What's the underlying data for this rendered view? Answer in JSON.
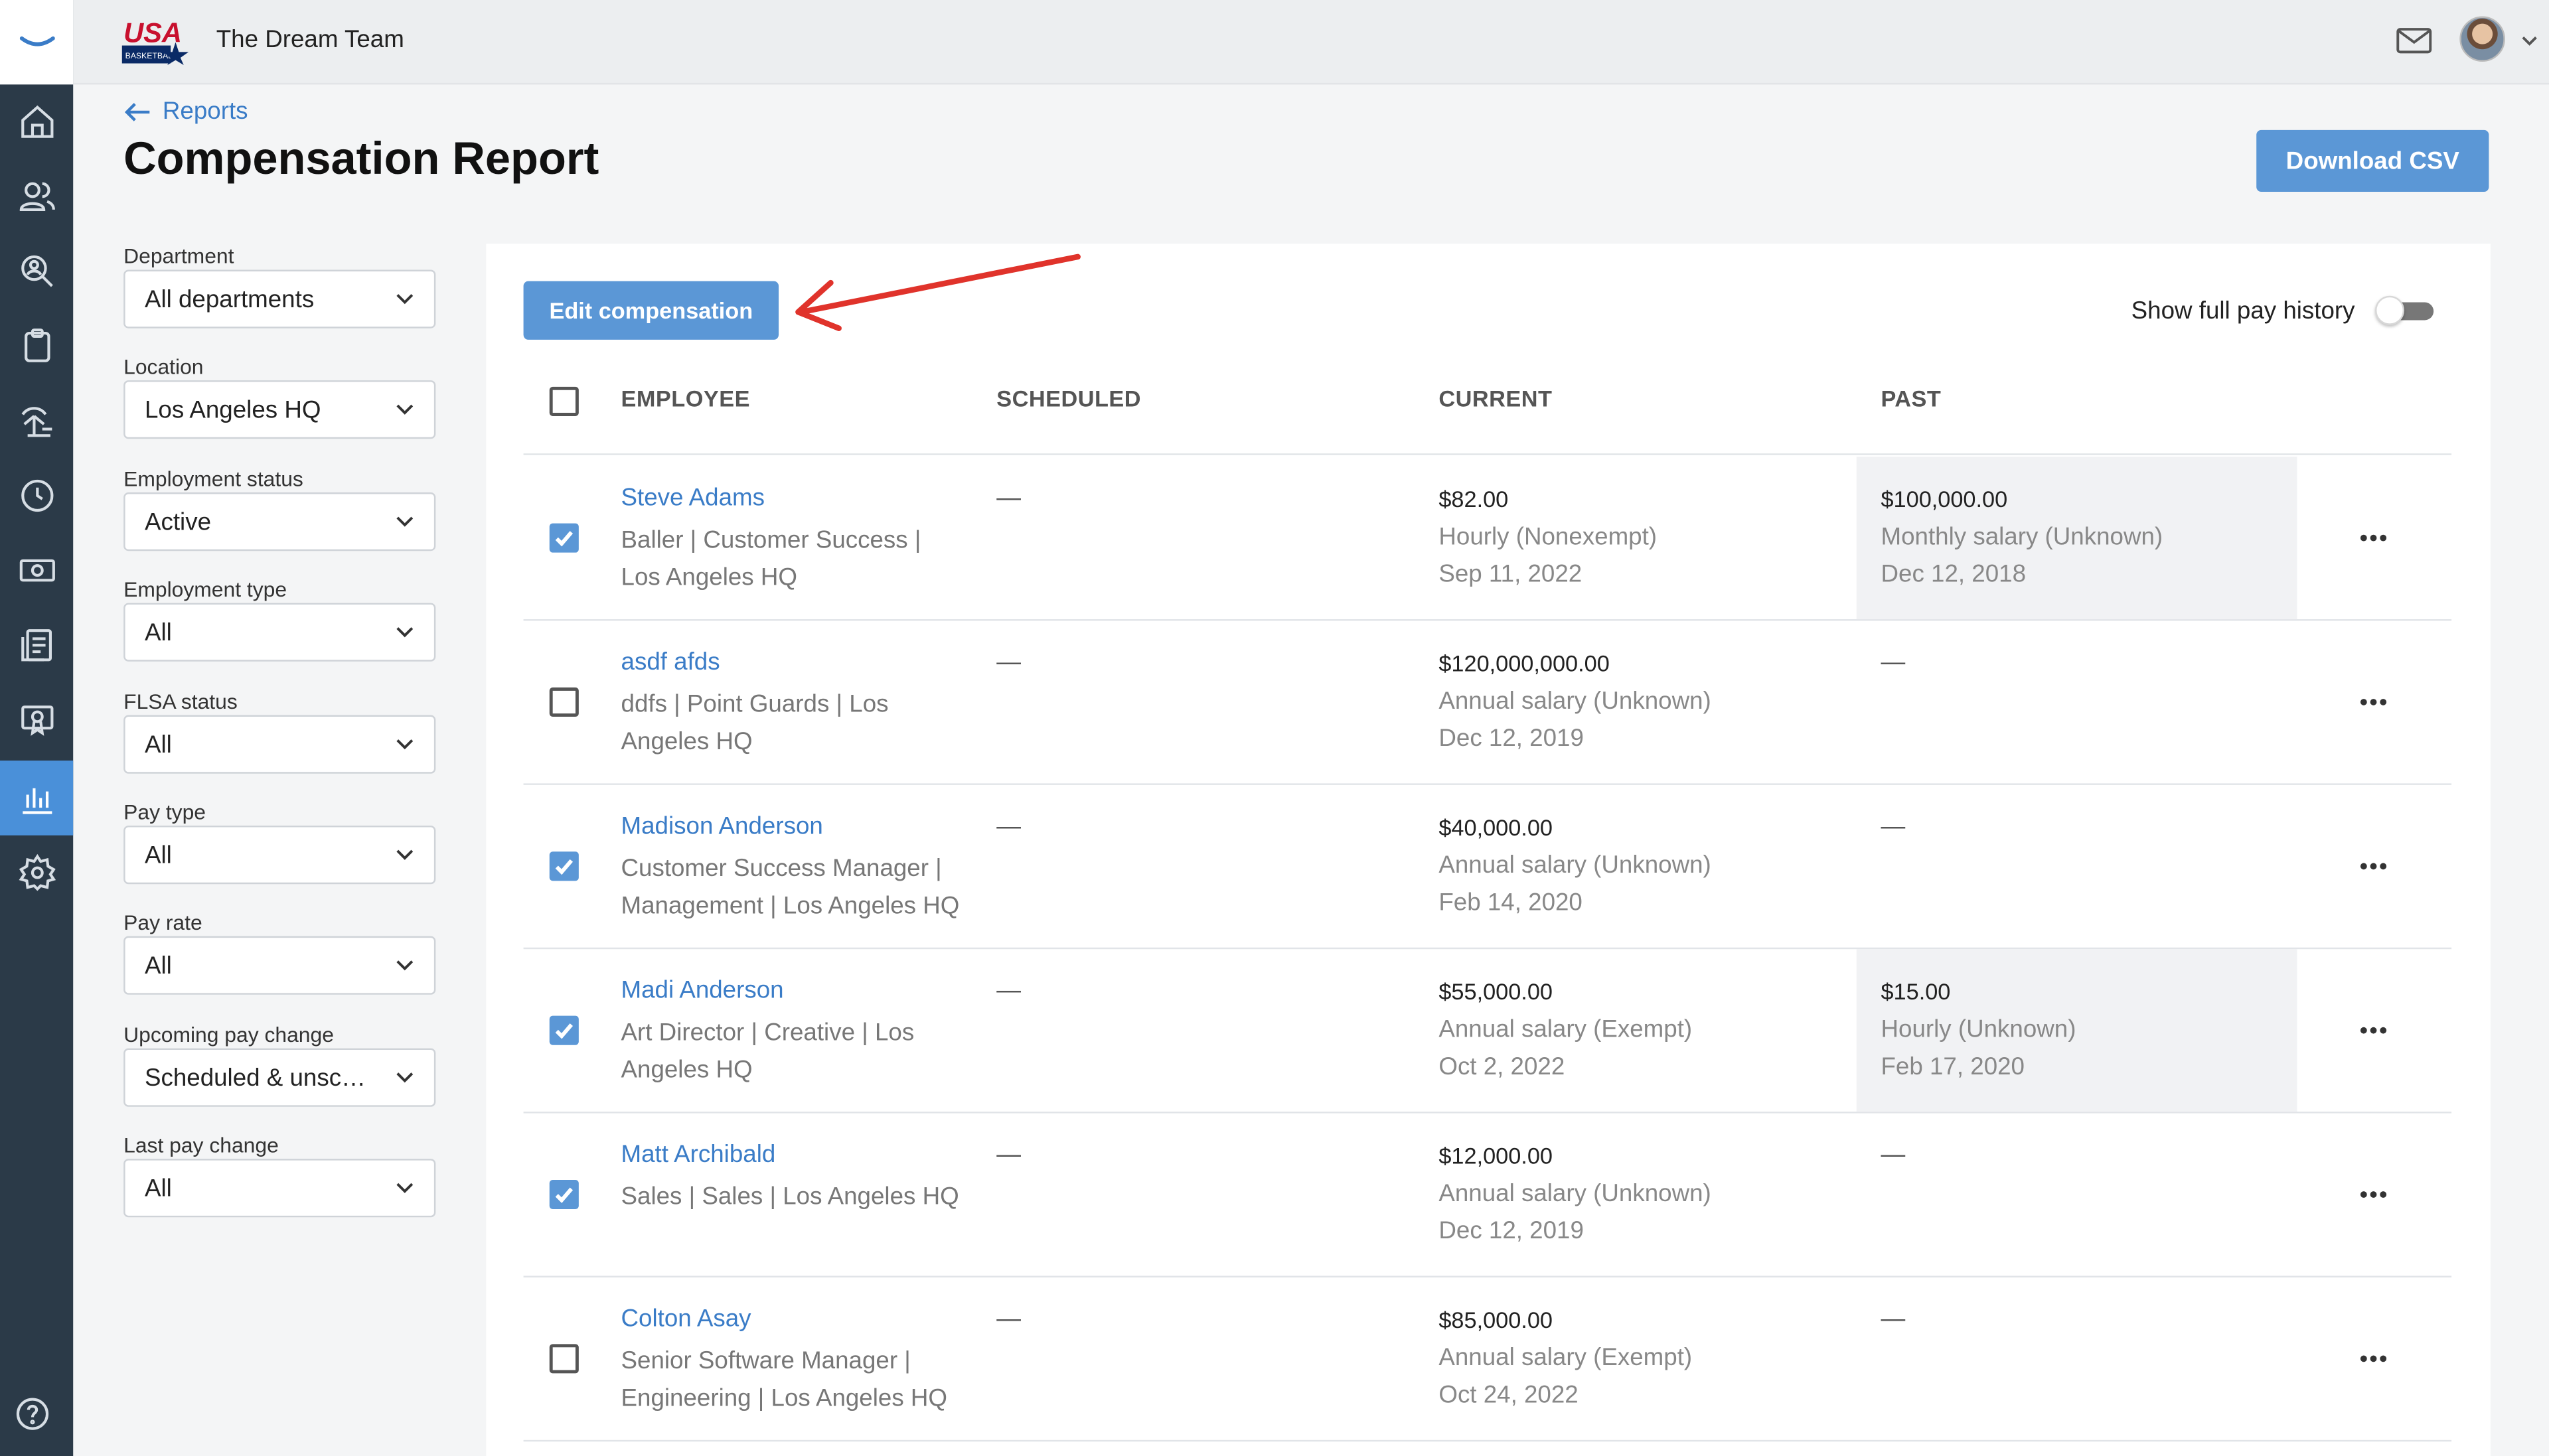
{
  "topbar": {
    "team_name": "The Dream Team"
  },
  "header": {
    "back_label": "Reports",
    "title": "Compensation Report",
    "download_label": "Download CSV"
  },
  "nav": [
    "home-icon",
    "people-icon",
    "search-person-icon",
    "clipboard-icon",
    "time-off-icon",
    "clock-icon",
    "money-icon",
    "documents-icon",
    "training-icon",
    "reports-icon",
    "settings-icon"
  ],
  "filters": [
    {
      "label": "Department",
      "value": "All departments"
    },
    {
      "label": "Location",
      "value": "Los Angeles HQ"
    },
    {
      "label": "Employment status",
      "value": "Active"
    },
    {
      "label": "Employment type",
      "value": "All"
    },
    {
      "label": "FLSA status",
      "value": "All"
    },
    {
      "label": "Pay type",
      "value": "All"
    },
    {
      "label": "Pay rate",
      "value": "All"
    },
    {
      "label": "Upcoming pay change",
      "value": "Scheduled & unscheduled"
    },
    {
      "label": "Last pay change",
      "value": "All"
    }
  ],
  "toolbar": {
    "edit_label": "Edit compensation",
    "toggle_label": "Show full pay history",
    "toggle_on": false
  },
  "table": {
    "headers": {
      "employee": "EMPLOYEE",
      "scheduled": "SCHEDULED",
      "current": "CURRENT",
      "past": "PAST"
    },
    "rows": [
      {
        "checked": true,
        "name": "Steve Adams",
        "details": "Baller | Customer Success | Los Angeles HQ",
        "scheduled": "—",
        "current": {
          "amount": "$82.00",
          "type": "Hourly (Nonexempt)",
          "date": "Sep 11, 2022"
        },
        "past": {
          "amount": "$100,000.00",
          "type": "Monthly salary (Unknown)",
          "date": "Dec 12, 2018"
        }
      },
      {
        "checked": false,
        "name": "asdf afds",
        "details": "ddfs | Point Guards | Los Angeles HQ",
        "scheduled": "—",
        "current": {
          "amount": "$120,000,000.00",
          "type": "Annual salary (Unknown)",
          "date": "Dec 12, 2019"
        },
        "past": {
          "dash": "—"
        }
      },
      {
        "checked": true,
        "name": "Madison Anderson",
        "details": "Customer Success Manager | Management | Los Angeles HQ",
        "scheduled": "—",
        "current": {
          "amount": "$40,000.00",
          "type": "Annual salary (Unknown)",
          "date": "Feb 14, 2020"
        },
        "past": {
          "dash": "—"
        }
      },
      {
        "checked": true,
        "name": "Madi Anderson",
        "details": "Art Director | Creative | Los Angeles HQ",
        "scheduled": "—",
        "current": {
          "amount": "$55,000.00",
          "type": "Annual salary (Exempt)",
          "date": "Oct 2, 2022"
        },
        "past": {
          "amount": "$15.00",
          "type": "Hourly (Unknown)",
          "date": "Feb 17, 2020"
        }
      },
      {
        "checked": true,
        "name": "Matt Archibald",
        "details": "Sales | Sales | Los Angeles HQ",
        "scheduled": "—",
        "current": {
          "amount": "$12,000.00",
          "type": "Annual salary (Unknown)",
          "date": "Dec 12, 2019"
        },
        "past": {
          "dash": "—"
        }
      },
      {
        "checked": false,
        "name": "Colton Asay",
        "details": "Senior Software Manager | Engineering | Los Angeles HQ",
        "scheduled": "—",
        "current": {
          "amount": "$85,000.00",
          "type": "Annual salary (Exempt)",
          "date": "Oct 24, 2022"
        },
        "past": {
          "dash": "—"
        }
      }
    ]
  },
  "colors": {
    "accent": "#5b97d6",
    "link": "#3a7cc7",
    "rail": "#2b3a48",
    "annotation_arrow": "#e0332b"
  }
}
